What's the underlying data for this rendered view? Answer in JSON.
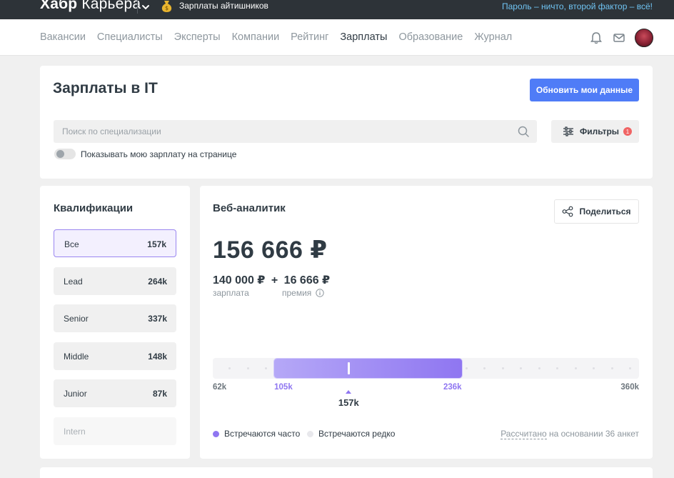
{
  "topbar": {
    "logo_bold": "Хабр",
    "logo_thin": "Карьера",
    "salary_link": "Зарплаты айтишников",
    "promo": "Пароль – ничто, второй фактор – всё!"
  },
  "nav": {
    "items": [
      "Вакансии",
      "Специалисты",
      "Эксперты",
      "Компании",
      "Рейтинг",
      "Зарплаты",
      "Образование",
      "Журнал"
    ],
    "active": "Зарплаты"
  },
  "header": {
    "title": "Зарплаты в IT",
    "update_button": "Обновить мои данные",
    "search_placeholder": "Поиск по специализации",
    "filters_label": "Фильтры",
    "filters_count": "1",
    "toggle_label": "Показывать мою зарплату на странице"
  },
  "qualifications": {
    "title": "Квалификации",
    "items": [
      {
        "label": "Все",
        "value": "157k"
      },
      {
        "label": "Lead",
        "value": "264k"
      },
      {
        "label": "Senior",
        "value": "337k"
      },
      {
        "label": "Middle",
        "value": "148k"
      },
      {
        "label": "Junior",
        "value": "87k"
      },
      {
        "label": "Intern",
        "value": ""
      }
    ]
  },
  "main": {
    "title": "Веб-аналитик",
    "share_label": "Поделиться",
    "total": "156 666 ₽",
    "salary": "140 000 ₽",
    "plus": "+",
    "bonus": "16 666 ₽",
    "salary_caption": "зарплата",
    "bonus_caption": "премия",
    "range": {
      "min_label": "62k",
      "low_label": "105k",
      "high_label": "236k",
      "max_label": "360k",
      "median_label": "157k",
      "min": 62,
      "low": 105,
      "high": 236,
      "max": 360,
      "median": 157
    },
    "legend_frequent": "Встречаются часто",
    "legend_rare": "Встречаются редко",
    "calc_link": "Рассчитано",
    "calc_rest": " на основании 36 анкет"
  },
  "colors": {
    "accent": "#4f7cf7",
    "range": "#8f76f1",
    "topbar": "#2d3338"
  }
}
